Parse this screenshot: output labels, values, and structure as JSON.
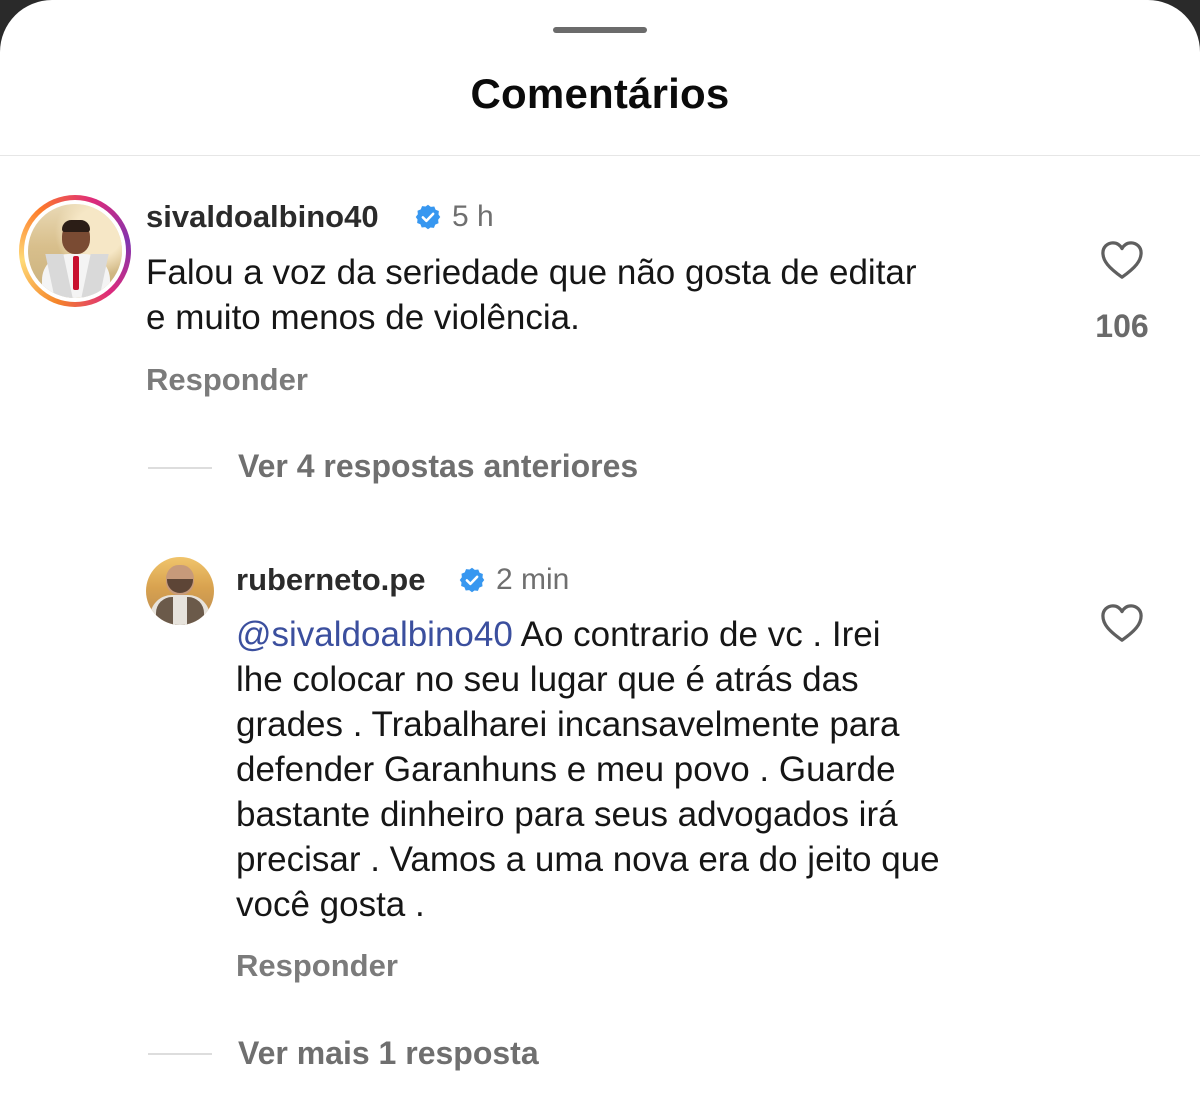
{
  "sheet": {
    "title": "Comentários"
  },
  "comments": [
    {
      "username": "sivaldoalbino40",
      "verified": true,
      "time": "5 h",
      "text_lines": [
        "Falou a voz da seriedade que não gosta de editar",
        "e muito menos de violência."
      ],
      "reply_label": "Responder",
      "likes": "106",
      "view_replies_label": "Ver 4 respostas anteriores"
    },
    {
      "username": "ruberneto.pe",
      "verified": true,
      "time": "2 min",
      "mention": "@sivaldoalbino40",
      "text_lines": [
        " Ao contrario de vc . Irei",
        "lhe colocar no seu lugar que é atrás das",
        "grades . Trabalharei incansavelmente para",
        "defender Garanhuns e meu povo . Guarde",
        "bastante dinheiro para seus advogados irá",
        "precisar . Vamos a uma nova era do jeito que",
        "você gosta ."
      ],
      "reply_label": "Responder",
      "view_replies_label": "Ver mais 1 resposta"
    }
  ],
  "colors": {
    "verified_badge": "#3797f0",
    "mention": "#3b4f9e",
    "secondary_text": "#6f6f6f"
  },
  "icons": {
    "verified": "verified-badge-icon",
    "like": "heart-outline-icon"
  }
}
